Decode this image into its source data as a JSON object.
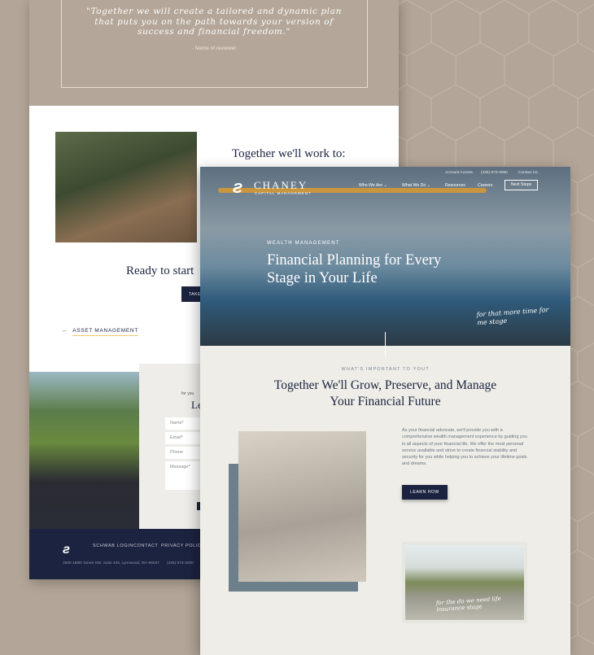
{
  "colors": {
    "background": "#b3a597",
    "navy": "#1c2340",
    "accent": "#f2c96b"
  },
  "back_page": {
    "quote": "\"Together we will create a tailored and dynamic plan that puts you on the path towards your version of success and financial freedom.\"",
    "reviewer": "- Name of reviewer",
    "work_heading": "Together we'll work to:",
    "ready_heading": "Ready to start",
    "take_button": "TAKE",
    "asset_link": "ASSET MANAGEMENT",
    "arrow_icon": "arrow-left-icon",
    "form": {
      "small": "for you",
      "title": "Le",
      "fields": [
        "Name*",
        "Email*",
        "Phone",
        "Message*"
      ]
    },
    "footer": {
      "links": [
        "SCHWAB LOGIN",
        "CONTACT",
        "PRIVACY POLICY"
      ],
      "address": "3500 188th Street SW, Suite 445, Lynnwood, WA 98037",
      "phone": "(425) 673-4060"
    }
  },
  "front_page": {
    "logo": {
      "name": "CHANEY",
      "sub": "CAPITAL MANAGEMENT"
    },
    "utility": [
      "Account Access",
      "(425) 673-4060",
      "Contact Us"
    ],
    "nav": [
      "Who We Are ⌄",
      "What We Do ⌄",
      "Resources",
      "Careers"
    ],
    "cta": "Next Steps",
    "hero": {
      "eyebrow": "WEALTH MANAGEMENT",
      "title": "Financial Planning for Every Stage in Your Life",
      "script": "for that more time for me stage"
    },
    "section": {
      "eyebrow": "WHAT'S IMPORTANT TO YOU?",
      "title": "Together We'll Grow, Preserve, and Manage Your Financial Future",
      "paragraph": "As your financial advocate, we'll provide you with a comprehensive wealth management experience by guiding you in all aspects of your financial life. We offer the most personal service available and strive to create financial stability and security for you while helping you to achieve your lifetime goals and dreams.",
      "button": "LEARN HOW",
      "script2": "for the do we need life insurance stage"
    }
  }
}
